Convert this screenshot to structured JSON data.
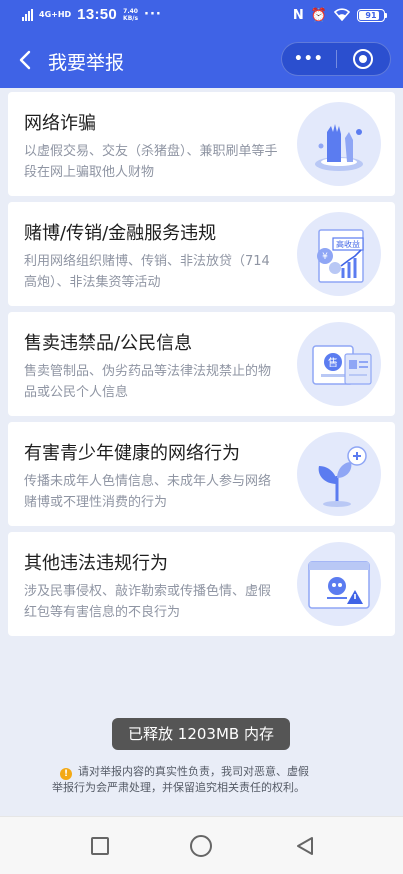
{
  "status_bar": {
    "network": "4G+HD",
    "time": "13:50",
    "speed_value": "7.40",
    "speed_unit": "KB/s",
    "more": "···",
    "battery": "91"
  },
  "nav": {
    "title": "我要举报",
    "more_label": "•••"
  },
  "cards": [
    {
      "title": "网络诈骗",
      "desc": "以虚假交易、交友（杀猪盘）、兼职刷单等手段在网上骗取他人财物",
      "icon": "scam-illustration-icon"
    },
    {
      "title": "赌博/传销/金融服务违规",
      "desc": "利用网络组织赌博、传销、非法放贷（714高炮）、非法集资等活动",
      "icon": "finance-illustration-icon",
      "badge": "高收益"
    },
    {
      "title": "售卖违禁品/公民信息",
      "desc": "售卖管制品、伪劣药品等法律法规禁止的物品或公民个人信息",
      "icon": "contraband-illustration-icon",
      "badge": "售"
    },
    {
      "title": "有害青少年健康的网络行为",
      "desc": "传播未成年人色情信息、未成年人参与网络赌博或不理性消费的行为",
      "icon": "youth-illustration-icon"
    },
    {
      "title": "其他违法违规行为",
      "desc": "涉及民事侵权、敲诈勒索或传播色情、虚假红包等有害信息的不良行为",
      "icon": "other-illustration-icon"
    }
  ],
  "toast": "已释放 1203MB 内存",
  "notice": {
    "line1": "请对举报内容的真实性负责，我司对恶意、虚假",
    "line2": "举报行为会严肃处理，并保留追究相关责任的权利。"
  },
  "colors": {
    "primary": "#3f63e6",
    "background": "#e9edf7",
    "warning": "#f3a915"
  }
}
